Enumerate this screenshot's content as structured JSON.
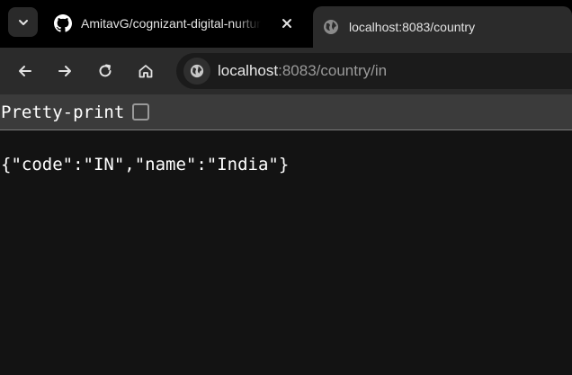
{
  "tabs": [
    {
      "title": "AmitavG/cognizant-digital-nurture",
      "icon": "github-icon",
      "active": false
    },
    {
      "title": "localhost:8083/country",
      "icon": "globe-icon",
      "active": true
    }
  ],
  "address_bar": {
    "host": "localhost",
    "rest": ":8083/country/in"
  },
  "pretty_print": {
    "label": "Pretty-print",
    "checked": false
  },
  "body_text": "{\"code\":\"IN\",\"name\":\"India\"}",
  "colors": {
    "tabbar_bg": "#000000",
    "toolbar_bg": "#2b2b2b",
    "page_bg": "#131313"
  }
}
